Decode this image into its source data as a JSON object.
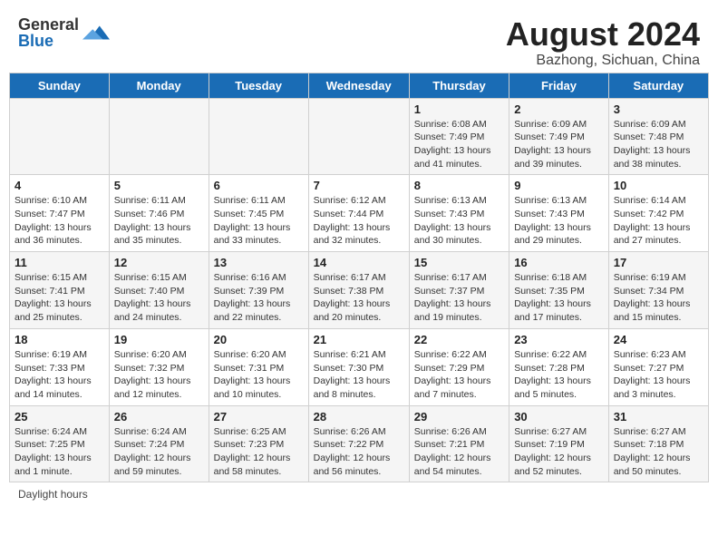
{
  "header": {
    "logo_general": "General",
    "logo_blue": "Blue",
    "month_year": "August 2024",
    "location": "Bazhong, Sichuan, China"
  },
  "weekdays": [
    "Sunday",
    "Monday",
    "Tuesday",
    "Wednesday",
    "Thursday",
    "Friday",
    "Saturday"
  ],
  "weeks": [
    [
      {
        "day": "",
        "sunrise": "",
        "sunset": "",
        "daylight": ""
      },
      {
        "day": "",
        "sunrise": "",
        "sunset": "",
        "daylight": ""
      },
      {
        "day": "",
        "sunrise": "",
        "sunset": "",
        "daylight": ""
      },
      {
        "day": "",
        "sunrise": "",
        "sunset": "",
        "daylight": ""
      },
      {
        "day": "1",
        "sunrise": "Sunrise: 6:08 AM",
        "sunset": "Sunset: 7:49 PM",
        "daylight": "Daylight: 13 hours and 41 minutes."
      },
      {
        "day": "2",
        "sunrise": "Sunrise: 6:09 AM",
        "sunset": "Sunset: 7:49 PM",
        "daylight": "Daylight: 13 hours and 39 minutes."
      },
      {
        "day": "3",
        "sunrise": "Sunrise: 6:09 AM",
        "sunset": "Sunset: 7:48 PM",
        "daylight": "Daylight: 13 hours and 38 minutes."
      }
    ],
    [
      {
        "day": "4",
        "sunrise": "Sunrise: 6:10 AM",
        "sunset": "Sunset: 7:47 PM",
        "daylight": "Daylight: 13 hours and 36 minutes."
      },
      {
        "day": "5",
        "sunrise": "Sunrise: 6:11 AM",
        "sunset": "Sunset: 7:46 PM",
        "daylight": "Daylight: 13 hours and 35 minutes."
      },
      {
        "day": "6",
        "sunrise": "Sunrise: 6:11 AM",
        "sunset": "Sunset: 7:45 PM",
        "daylight": "Daylight: 13 hours and 33 minutes."
      },
      {
        "day": "7",
        "sunrise": "Sunrise: 6:12 AM",
        "sunset": "Sunset: 7:44 PM",
        "daylight": "Daylight: 13 hours and 32 minutes."
      },
      {
        "day": "8",
        "sunrise": "Sunrise: 6:13 AM",
        "sunset": "Sunset: 7:43 PM",
        "daylight": "Daylight: 13 hours and 30 minutes."
      },
      {
        "day": "9",
        "sunrise": "Sunrise: 6:13 AM",
        "sunset": "Sunset: 7:43 PM",
        "daylight": "Daylight: 13 hours and 29 minutes."
      },
      {
        "day": "10",
        "sunrise": "Sunrise: 6:14 AM",
        "sunset": "Sunset: 7:42 PM",
        "daylight": "Daylight: 13 hours and 27 minutes."
      }
    ],
    [
      {
        "day": "11",
        "sunrise": "Sunrise: 6:15 AM",
        "sunset": "Sunset: 7:41 PM",
        "daylight": "Daylight: 13 hours and 25 minutes."
      },
      {
        "day": "12",
        "sunrise": "Sunrise: 6:15 AM",
        "sunset": "Sunset: 7:40 PM",
        "daylight": "Daylight: 13 hours and 24 minutes."
      },
      {
        "day": "13",
        "sunrise": "Sunrise: 6:16 AM",
        "sunset": "Sunset: 7:39 PM",
        "daylight": "Daylight: 13 hours and 22 minutes."
      },
      {
        "day": "14",
        "sunrise": "Sunrise: 6:17 AM",
        "sunset": "Sunset: 7:38 PM",
        "daylight": "Daylight: 13 hours and 20 minutes."
      },
      {
        "day": "15",
        "sunrise": "Sunrise: 6:17 AM",
        "sunset": "Sunset: 7:37 PM",
        "daylight": "Daylight: 13 hours and 19 minutes."
      },
      {
        "day": "16",
        "sunrise": "Sunrise: 6:18 AM",
        "sunset": "Sunset: 7:35 PM",
        "daylight": "Daylight: 13 hours and 17 minutes."
      },
      {
        "day": "17",
        "sunrise": "Sunrise: 6:19 AM",
        "sunset": "Sunset: 7:34 PM",
        "daylight": "Daylight: 13 hours and 15 minutes."
      }
    ],
    [
      {
        "day": "18",
        "sunrise": "Sunrise: 6:19 AM",
        "sunset": "Sunset: 7:33 PM",
        "daylight": "Daylight: 13 hours and 14 minutes."
      },
      {
        "day": "19",
        "sunrise": "Sunrise: 6:20 AM",
        "sunset": "Sunset: 7:32 PM",
        "daylight": "Daylight: 13 hours and 12 minutes."
      },
      {
        "day": "20",
        "sunrise": "Sunrise: 6:20 AM",
        "sunset": "Sunset: 7:31 PM",
        "daylight": "Daylight: 13 hours and 10 minutes."
      },
      {
        "day": "21",
        "sunrise": "Sunrise: 6:21 AM",
        "sunset": "Sunset: 7:30 PM",
        "daylight": "Daylight: 13 hours and 8 minutes."
      },
      {
        "day": "22",
        "sunrise": "Sunrise: 6:22 AM",
        "sunset": "Sunset: 7:29 PM",
        "daylight": "Daylight: 13 hours and 7 minutes."
      },
      {
        "day": "23",
        "sunrise": "Sunrise: 6:22 AM",
        "sunset": "Sunset: 7:28 PM",
        "daylight": "Daylight: 13 hours and 5 minutes."
      },
      {
        "day": "24",
        "sunrise": "Sunrise: 6:23 AM",
        "sunset": "Sunset: 7:27 PM",
        "daylight": "Daylight: 13 hours and 3 minutes."
      }
    ],
    [
      {
        "day": "25",
        "sunrise": "Sunrise: 6:24 AM",
        "sunset": "Sunset: 7:25 PM",
        "daylight": "Daylight: 13 hours and 1 minute."
      },
      {
        "day": "26",
        "sunrise": "Sunrise: 6:24 AM",
        "sunset": "Sunset: 7:24 PM",
        "daylight": "Daylight: 12 hours and 59 minutes."
      },
      {
        "day": "27",
        "sunrise": "Sunrise: 6:25 AM",
        "sunset": "Sunset: 7:23 PM",
        "daylight": "Daylight: 12 hours and 58 minutes."
      },
      {
        "day": "28",
        "sunrise": "Sunrise: 6:26 AM",
        "sunset": "Sunset: 7:22 PM",
        "daylight": "Daylight: 12 hours and 56 minutes."
      },
      {
        "day": "29",
        "sunrise": "Sunrise: 6:26 AM",
        "sunset": "Sunset: 7:21 PM",
        "daylight": "Daylight: 12 hours and 54 minutes."
      },
      {
        "day": "30",
        "sunrise": "Sunrise: 6:27 AM",
        "sunset": "Sunset: 7:19 PM",
        "daylight": "Daylight: 12 hours and 52 minutes."
      },
      {
        "day": "31",
        "sunrise": "Sunrise: 6:27 AM",
        "sunset": "Sunset: 7:18 PM",
        "daylight": "Daylight: 12 hours and 50 minutes."
      }
    ]
  ],
  "footer": {
    "daylight_hours": "Daylight hours"
  }
}
